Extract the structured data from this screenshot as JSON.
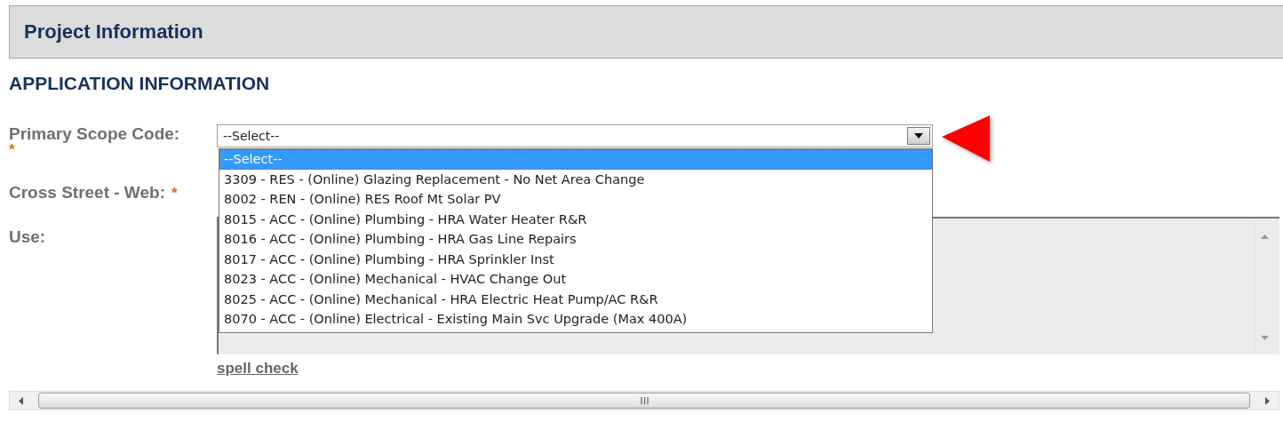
{
  "panel": {
    "title": "Project Information"
  },
  "section_title": "APPLICATION INFORMATION",
  "fields": [
    {
      "kind": "select",
      "label": "Primary Scope Code:",
      "required_mark": "*",
      "value": "--Select--",
      "expanded": true,
      "options": [
        {
          "label": "--Select--",
          "selected": true
        },
        {
          "label": "3309 - RES - (Online) Glazing Replacement - No Net Area Change",
          "selected": false
        },
        {
          "label": "8002 - REN - (Online) RES Roof Mt Solar PV",
          "selected": false
        },
        {
          "label": "8015 - ACC - (Online) Plumbing - HRA Water Heater R&R",
          "selected": false
        },
        {
          "label": "8016 - ACC - (Online) Plumbing - HRA Gas Line Repairs",
          "selected": false
        },
        {
          "label": "8017 - ACC - (Online) Plumbing - HRA Sprinkler Inst",
          "selected": false
        },
        {
          "label": "8023 - ACC - (Online) Mechanical - HVAC Change Out",
          "selected": false
        },
        {
          "label": "8025 - ACC - (Online) Mechanical - HRA Electric Heat Pump/AC R&R",
          "selected": false
        },
        {
          "label": "8070 - ACC - (Online) Electrical - Existing Main Svc Upgrade (Max 400A)",
          "selected": false
        }
      ]
    },
    {
      "kind": "text",
      "label": "Cross Street - Web:",
      "required_mark": "*"
    },
    {
      "kind": "textarea",
      "label": "Use:",
      "link": "spell check"
    }
  ]
}
